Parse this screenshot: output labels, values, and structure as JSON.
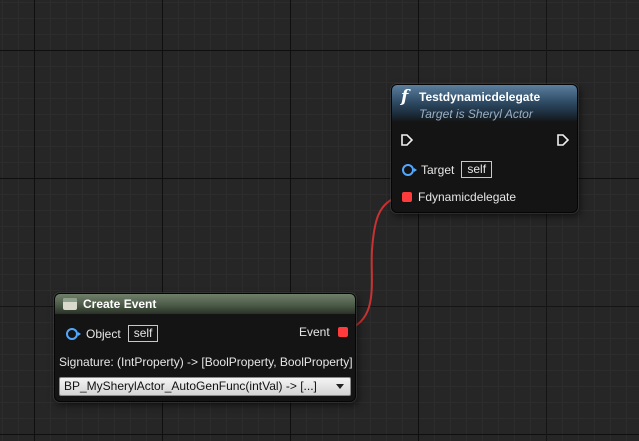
{
  "function_node": {
    "title": "Testdynamicdelegate",
    "subtitle": "Target is Sheryl Actor",
    "icon": "function-icon",
    "target_label": "Target",
    "target_value": "self",
    "delegate_label": "Fdynamicdelegate"
  },
  "create_event_node": {
    "title": "Create Event",
    "icon": "event-node-icon",
    "object_label": "Object",
    "object_value": "self",
    "event_label": "Event",
    "signature": "Signature: (IntProperty) -> [BoolProperty, BoolProperty]",
    "function_selected": "BP_MySherylActor_AutoGenFunc(intVal) -> [...]"
  },
  "colors": {
    "background": "#262626",
    "object_pin": "#52a8ff",
    "delegate_pin": "#ff3b3b",
    "wire": "#c83232",
    "function_header": "#2f4c66",
    "event_header": "#4b5b47"
  }
}
